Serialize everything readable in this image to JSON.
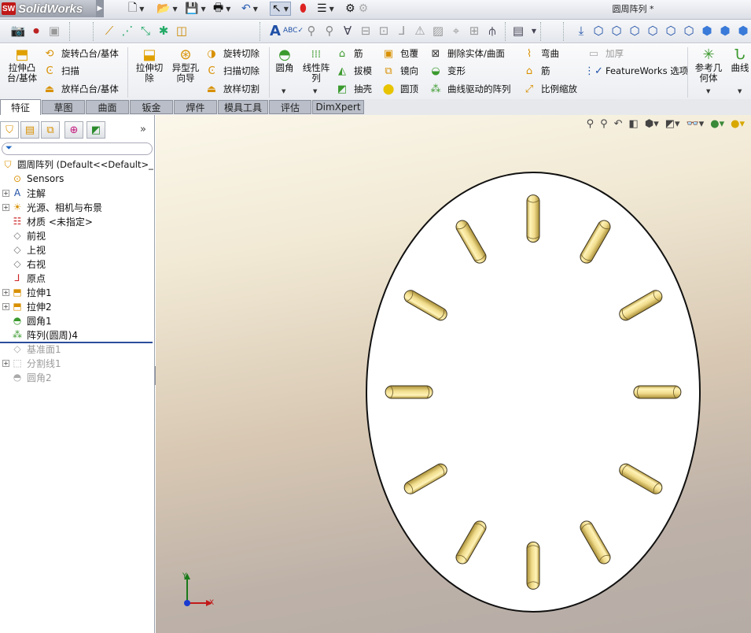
{
  "app": {
    "name": "SolidWorks",
    "badge": "SW",
    "document_title": "圆周阵列 *"
  },
  "topbar": {
    "icons": [
      "new-document-icon",
      "open-folder-icon",
      "save-icon",
      "print-icon",
      "undo-icon",
      "select-arrow-icon",
      "rebuild-traffic-light-icon",
      "file-properties-icon",
      "options-icon"
    ]
  },
  "command_manager": {
    "big_buttons": [
      {
        "name": "extruded-boss",
        "label_line1": "拉伸凸",
        "label_line2": "台/基体"
      },
      {
        "name": "extruded-cut",
        "label_line1": "拉伸切",
        "label_line2": "除"
      },
      {
        "name": "hole-wizard",
        "label_line1": "异型孔",
        "label_line2": "向导"
      },
      {
        "name": "fillet",
        "label_line1": "圆角",
        "label_line2": ""
      },
      {
        "name": "linear-pattern",
        "label_line1": "线性阵",
        "label_line2": "列"
      },
      {
        "name": "reference-geometry",
        "label_line1": "参考几",
        "label_line2": "何体"
      },
      {
        "name": "curves",
        "label_line1": "曲线",
        "label_line2": ""
      }
    ],
    "small_buttons": {
      "revolved_boss": "旋转凸台/基体",
      "sweep": "扫描",
      "loft": "放样凸台/基体",
      "revolved_cut": "旋转切除",
      "swept_cut": "扫描切除",
      "lofted_cut": "放样切割",
      "rib": "筋",
      "draft": "拔模",
      "shell": "抽壳",
      "wrap": "包覆",
      "mirror": "镜向",
      "dome": "圆顶",
      "delete_body": "删除实体/曲面",
      "deform": "变形",
      "curve_driven_pattern": "曲线驱动的阵列",
      "flex": "弯曲",
      "rib2": "筋",
      "scale": "比例缩放",
      "thicken": "加厚",
      "featureworks": "FeatureWorks 选项"
    }
  },
  "tabs": [
    {
      "label": "特征",
      "active": true
    },
    {
      "label": "草图",
      "active": false
    },
    {
      "label": "曲面",
      "active": false
    },
    {
      "label": "钣金",
      "active": false
    },
    {
      "label": "焊件",
      "active": false
    },
    {
      "label": "模具工具",
      "active": false
    },
    {
      "label": "评估",
      "active": false
    },
    {
      "label": "DimXpert",
      "active": false
    }
  ],
  "feature_tree": {
    "root": {
      "label": "圆周阵列  (Default<<Default>_"
    },
    "items": [
      {
        "label": "Sensors",
        "icon": "sensors-icon",
        "expandable": false,
        "suppressed": false
      },
      {
        "label": "注解",
        "icon": "annotations-icon",
        "expandable": true,
        "suppressed": false
      },
      {
        "label": "光源、相机与布景",
        "icon": "lights-cameras-icon",
        "expandable": true,
        "suppressed": false
      },
      {
        "label": "材质 <未指定>",
        "icon": "material-icon",
        "expandable": false,
        "suppressed": false
      },
      {
        "label": "前视",
        "icon": "plane-icon",
        "expandable": false,
        "suppressed": false
      },
      {
        "label": "上视",
        "icon": "plane-icon",
        "expandable": false,
        "suppressed": false
      },
      {
        "label": "右视",
        "icon": "plane-icon",
        "expandable": false,
        "suppressed": false
      },
      {
        "label": "原点",
        "icon": "origin-icon",
        "expandable": false,
        "suppressed": false
      },
      {
        "label": "拉伸1",
        "icon": "extrude-feature-icon",
        "expandable": true,
        "suppressed": false
      },
      {
        "label": "拉伸2",
        "icon": "extrude-feature-icon",
        "expandable": true,
        "suppressed": false
      },
      {
        "label": "圆角1",
        "icon": "fillet-feature-icon",
        "expandable": false,
        "suppressed": false
      },
      {
        "label": "阵列(圆周)4",
        "icon": "circular-pattern-icon",
        "expandable": false,
        "suppressed": false
      },
      {
        "label": "基准面1",
        "icon": "plane-icon",
        "expandable": false,
        "suppressed": true
      },
      {
        "label": "分割线1",
        "icon": "split-line-icon",
        "expandable": true,
        "suppressed": true
      },
      {
        "label": "圆角2",
        "icon": "fillet-feature-icon",
        "expandable": false,
        "suppressed": true
      }
    ]
  },
  "viewport": {
    "model": "disk-with-circular-pattern-slots",
    "slot_count": 12,
    "disk_color": "#ffffff",
    "slot_color": "#f0dc8c",
    "triad": {
      "x_label": "X",
      "y_label": "Y"
    }
  }
}
